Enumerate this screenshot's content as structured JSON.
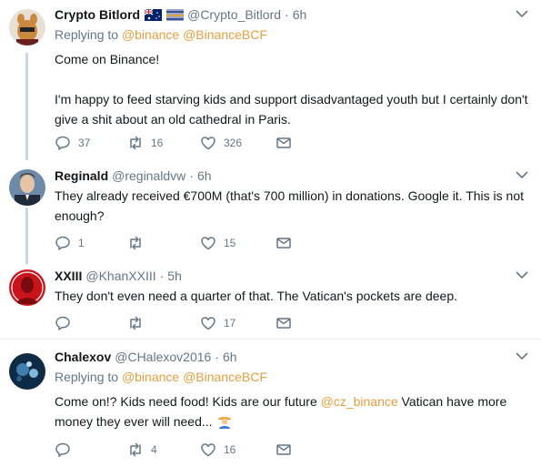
{
  "tweets": [
    {
      "name": "Crypto Bitlord",
      "flag_icon": "australia-flag-icon",
      "extra_icon": "flag-stripes-icon",
      "handle": "@Crypto_Bitlord",
      "time": "6h",
      "replying_label": "Replying to",
      "replying_to": [
        "@binance",
        "@BinanceBCF"
      ],
      "text_line1": "Come on Binance!",
      "text_line2": "I'm happy to feed starving kids and support disadvantaged youth but I certainly don't give a shit about an old cathedral in Paris.",
      "replies": "37",
      "retweets": "16",
      "likes": "326"
    },
    {
      "name": "Reginald",
      "handle": "@reginaldvw",
      "time": "6h",
      "text": "They already received €700M (that's 700 million) in donations. Google it. This is not enough?",
      "replies": "1",
      "retweets": "",
      "likes": "15"
    },
    {
      "name": "XXIII",
      "handle": "@KhanXXIII",
      "time": "5h",
      "text": "They don't even need a quarter of that. The Vatican's pockets are deep.",
      "replies": "",
      "retweets": "",
      "likes": "17"
    },
    {
      "name": "Chalexov",
      "handle": "@CHalexov2016",
      "time": "6h",
      "replying_label": "Replying to",
      "replying_to": [
        "@binance",
        "@BinanceBCF"
      ],
      "text_a": "Come on!? Kids need food! Kids are our future ",
      "text_mention": "@cz_binance",
      "text_b": " Vatican have more money they ever will need...",
      "emoji_icon": "farmer-emoji-icon",
      "replies": "",
      "retweets": "4",
      "likes": "16"
    }
  ],
  "colors": {
    "link": "#e2a03f",
    "muted": "#657786",
    "divider": "#e6ecf0",
    "thread": "#ccd6dd"
  },
  "icons": {
    "reply": "reply-icon",
    "retweet": "retweet-icon",
    "like": "heart-icon",
    "dm": "envelope-icon",
    "more": "chevron-down-icon"
  }
}
